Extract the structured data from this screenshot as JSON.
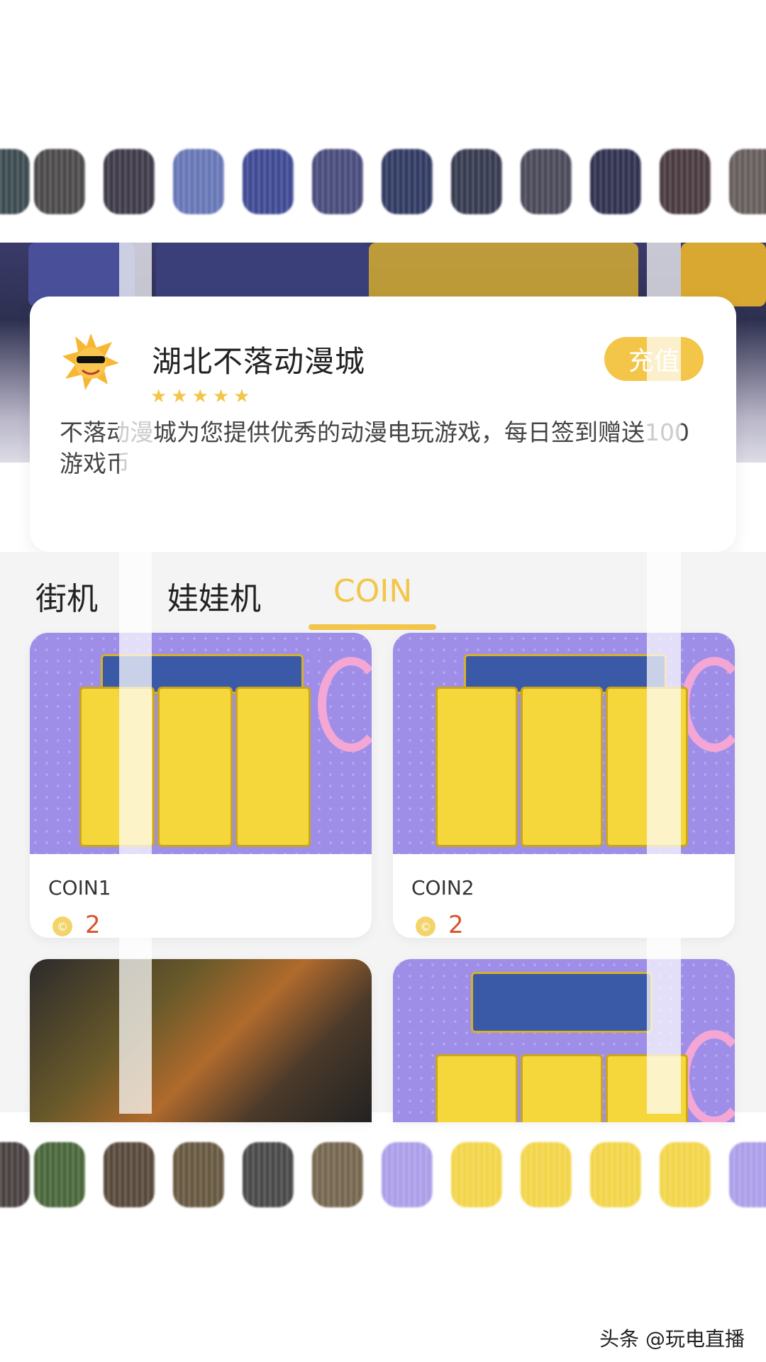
{
  "shop": {
    "name": "湖北不落动漫城",
    "rating_stars": "★★★★★",
    "description": "不落动漫城为您提供优秀的动漫电玩游戏，每日签到赠送100游戏币",
    "charge_button": "充值"
  },
  "tabs": [
    {
      "label": "街机",
      "active": false
    },
    {
      "label": "娃娃机",
      "active": false
    },
    {
      "label": "COIN",
      "active": true
    }
  ],
  "products": [
    {
      "name": "COIN1",
      "price": "2",
      "coin_symbol": "©"
    },
    {
      "name": "COIN2",
      "price": "2",
      "coin_symbol": "©"
    }
  ],
  "watermark": "头条 @玩电直播",
  "colors": {
    "accent": "#f3c64a",
    "price": "#d9532b",
    "card_bg": "#ffffff",
    "page_bg": "#f4f4f4",
    "product_bg": "#9e8ee8"
  },
  "icons": [
    "sun-mascot-icon",
    "coin-icon",
    "star-icon"
  ]
}
